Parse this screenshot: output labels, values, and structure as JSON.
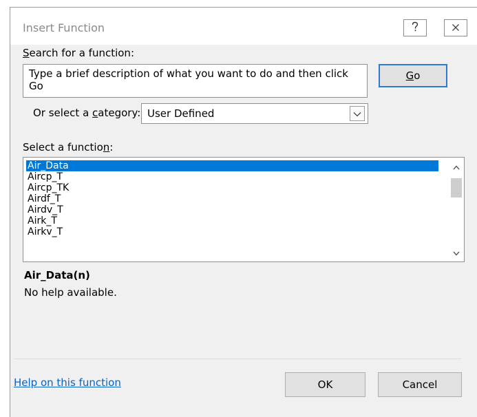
{
  "window": {
    "title": "Insert Function",
    "help_icon": "question-mark-icon",
    "close_icon": "close-icon"
  },
  "search": {
    "label_first": "S",
    "label_rest": "earch for a function:",
    "value": "Type a brief description of what you want to do and then click Go",
    "go_first": "G",
    "go_rest": "o"
  },
  "category": {
    "label_pre": "Or select a ",
    "label_ul": "c",
    "label_post": "ategory:",
    "selected": "User Defined",
    "arrow_icon": "chevron-down-icon"
  },
  "functions": {
    "label_pre": "Select a functio",
    "label_ul": "n",
    "label_post": ":",
    "items": [
      "Air_Data",
      "Aircp_T",
      "Aircp_TK",
      "Airdf_T",
      "Airdv_T",
      "Airk_T",
      "Airkv_T"
    ],
    "selected_index": 0
  },
  "details": {
    "signature": "Air_Data(n)",
    "help": "No help available."
  },
  "footer": {
    "help_link": "Help on this function",
    "ok": "OK",
    "cancel": "Cancel"
  },
  "colors": {
    "selection": "#0078d7",
    "link": "#0b63c1",
    "default_button_border": "#2b78d6"
  }
}
